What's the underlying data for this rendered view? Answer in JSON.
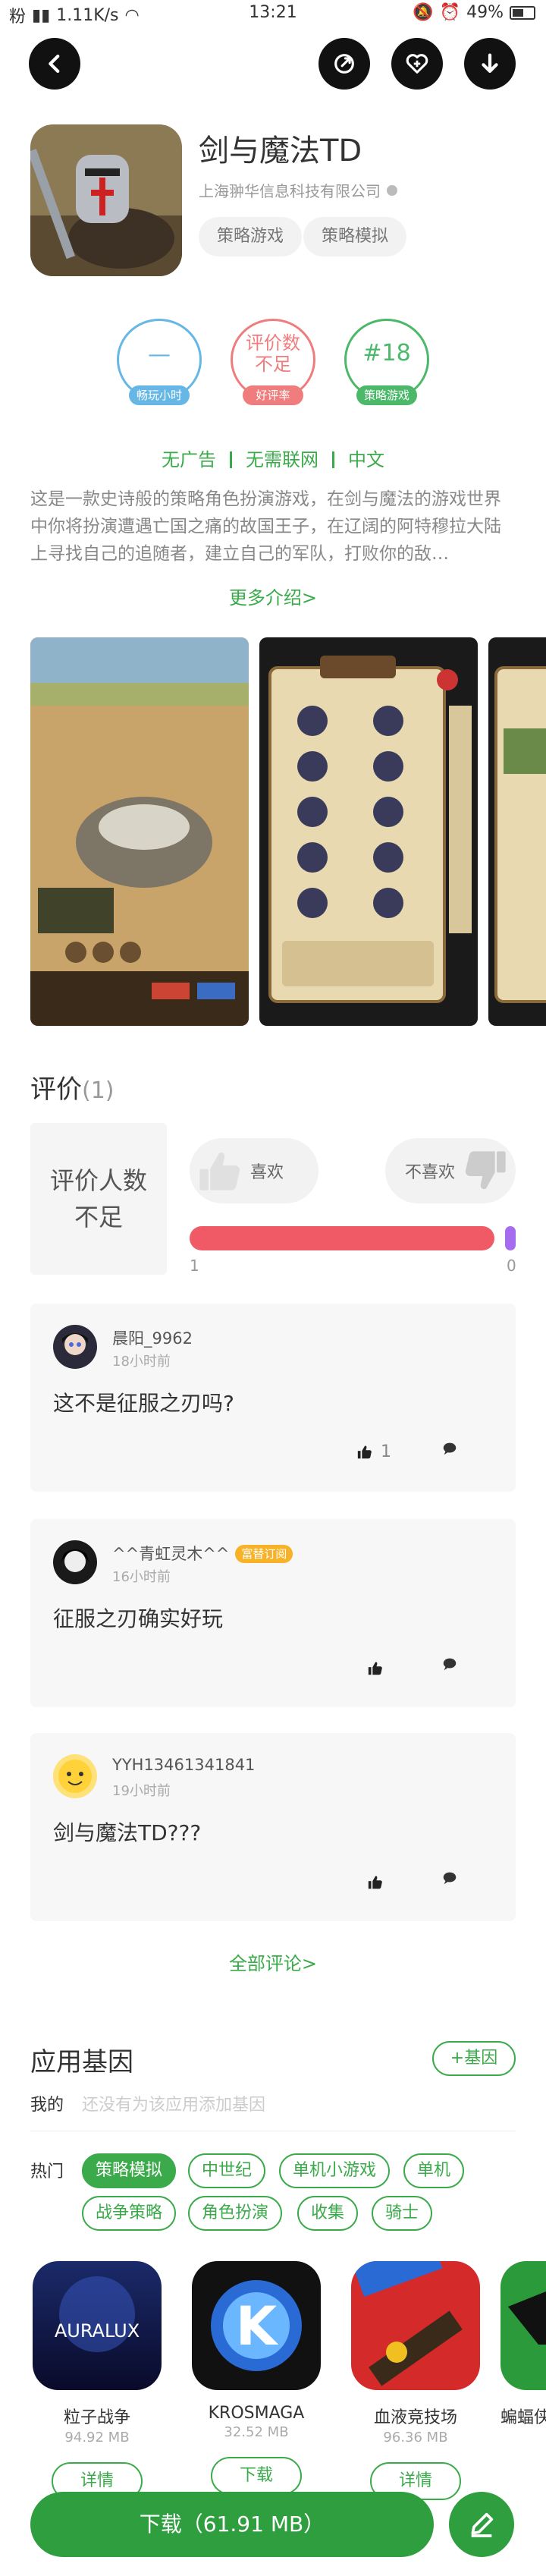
{
  "status_bar": {
    "carrier": "粉",
    "speed": "1.11K/s",
    "time": "13:21",
    "battery": "49%"
  },
  "app": {
    "title": "剑与魔法TD",
    "developer": "上海翀华信息科技有限公司",
    "tags": [
      "策略游戏",
      "策略模拟"
    ]
  },
  "badges": [
    {
      "value": "—",
      "label": "畅玩小时",
      "color": "#66b6e6"
    },
    {
      "value": "评价数\n不足",
      "label": "好评率",
      "color": "#f07d7d"
    },
    {
      "value": "#18",
      "label": "策略游戏",
      "color": "#4cb86a"
    }
  ],
  "features": [
    "无广告",
    "无需联网",
    "中文"
  ],
  "description": "这是一款史诗般的策略角色扮演游戏，在剑与魔法的游戏世界中你将扮演遭遇亡国之痛的故国王子，在辽阔的阿特穆拉大陆上寻找自己的追随者，建立自己的军队，打败你的敌…",
  "more_link": "更多介绍>",
  "ratings": {
    "title": "评价",
    "count": "(1)",
    "box_text": "评价人数不足",
    "like_label": "喜欢",
    "dislike_label": "不喜欢",
    "like_count": "1",
    "dislike_count": "0",
    "like_fraction": 1.0
  },
  "comments": [
    {
      "name": "晨阳_9962",
      "time": "18小时前",
      "text": "这不是征服之刃吗?",
      "likes": "1",
      "vip": ""
    },
    {
      "name": "^^青虹灵木^^",
      "time": "16小时前",
      "text": "征服之刃确实好玩",
      "likes": "",
      "vip": "富替订阅"
    },
    {
      "name": "YYH13461341841",
      "time": "19小时前",
      "text": "剑与魔法TD???",
      "likes": "",
      "vip": ""
    }
  ],
  "all_comments": "全部评论>",
  "genes": {
    "title": "应用基因",
    "add_label": "+基因",
    "my_label": "我的",
    "my_placeholder": "还没有为该应用添加基因",
    "hot_label": "热门",
    "chips": [
      "策略模拟",
      "中世纪",
      "单机小游戏",
      "单机",
      "战争策略",
      "角色扮演",
      "收集",
      "骑士"
    ]
  },
  "recommended": [
    {
      "name": "粒子战争",
      "size": "94.92 MB",
      "button": "详情"
    },
    {
      "name": "KROSMAGA",
      "size": "32.52 MB",
      "button": "下载"
    },
    {
      "name": "血液竞技场",
      "size": "96.36 MB",
      "button": "详情"
    },
    {
      "name": "蝙蝠侠",
      "size": "",
      "button": ""
    }
  ],
  "download_button": "下载（61.91 MB）",
  "colors": {
    "accent": "#3aaa4a",
    "download": "#2f9e3f",
    "like_bar": "#f05a66",
    "dislike_bar": "#a66cf0"
  }
}
